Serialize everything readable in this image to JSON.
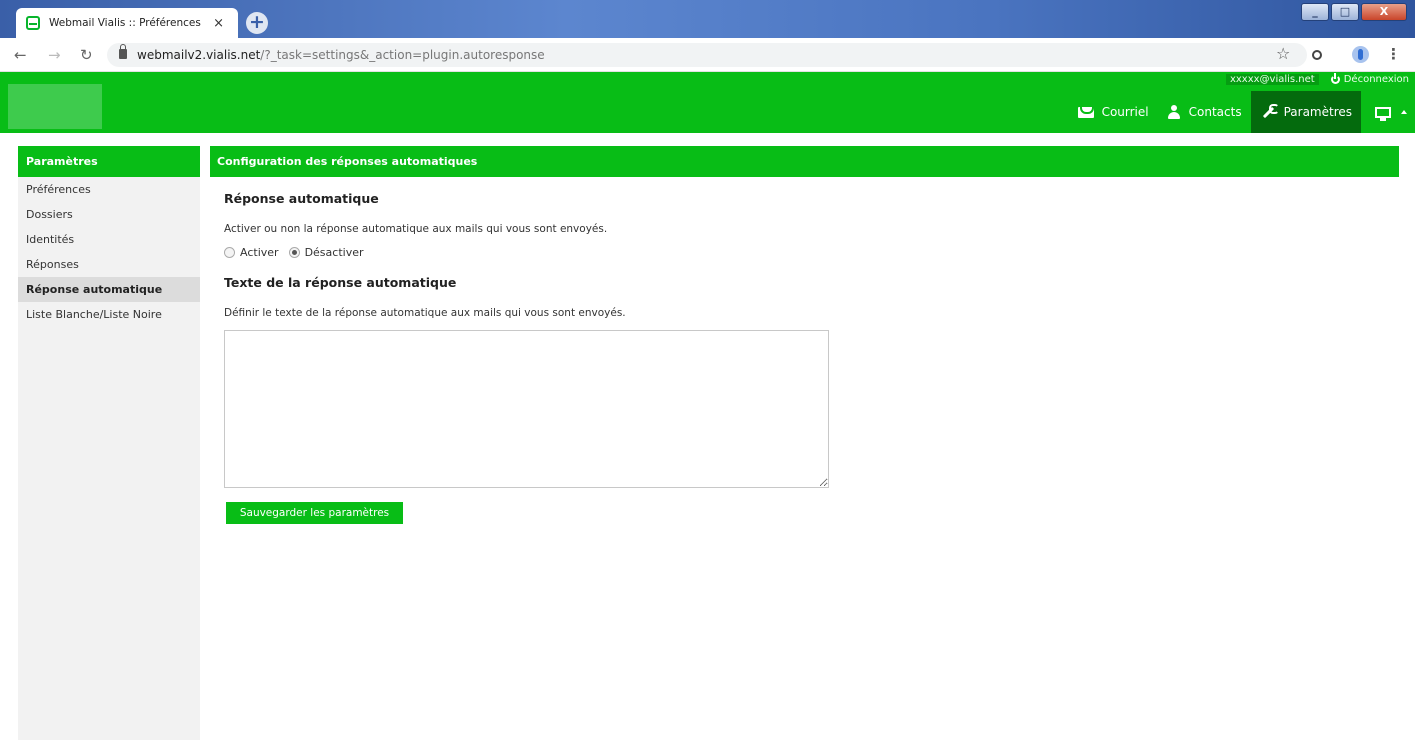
{
  "browser": {
    "tab_title": "Webmail Vialis :: Préférences",
    "tab_close": "×",
    "new_tab": "+",
    "url_host": "webmailv2.vialis.net",
    "url_rest": "/?_task=settings&_action=plugin.autoresponse",
    "win_minimize": "_",
    "win_maximize": "□",
    "win_close": "X"
  },
  "header": {
    "user_email": "xxxxx@vialis.net",
    "logout_label": "Déconnexion",
    "nav": [
      {
        "label": "Courriel",
        "icon": "mail-icon"
      },
      {
        "label": "Contacts",
        "icon": "contact-icon"
      },
      {
        "label": "Paramètres",
        "icon": "wrench-icon",
        "active": true
      }
    ]
  },
  "sidebar": {
    "title": "Paramètres",
    "items": [
      {
        "label": "Préférences"
      },
      {
        "label": "Dossiers"
      },
      {
        "label": "Identités"
      },
      {
        "label": "Réponses"
      },
      {
        "label": "Réponse automatique",
        "selected": true
      },
      {
        "label": "Liste Blanche/Liste Noire"
      }
    ]
  },
  "main": {
    "header": "Configuration des réponses automatiques",
    "section1_title": "Réponse automatique",
    "section1_desc": "Activer ou non la réponse automatique aux mails qui vous sont envoyés.",
    "radio_on_label": "Activer",
    "radio_off_label": "Désactiver",
    "radio_selected": "Désactiver",
    "section2_title": "Texte de la réponse automatique",
    "section2_desc": "Définir le texte de la réponse automatique aux mails qui vous sont envoyés.",
    "reply_text_value": "",
    "save_label": "Sauvegarder les paramètres"
  },
  "colors": {
    "brand_green": "#08bd16",
    "active_nav": "#046b0d"
  }
}
